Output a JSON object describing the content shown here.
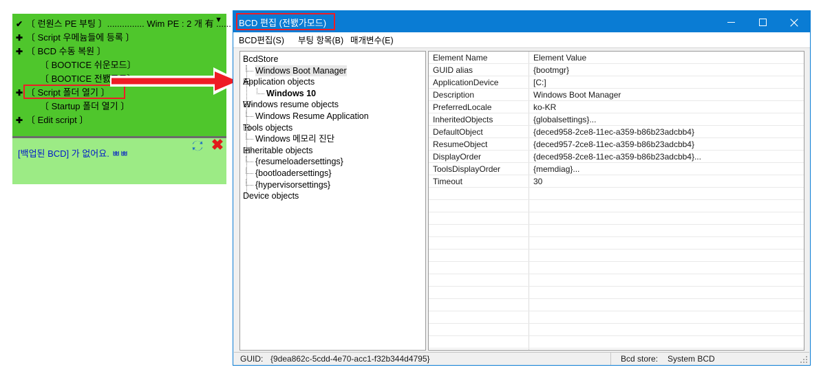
{
  "colors": {
    "accent_blue": "#0a7cd4",
    "panel_green": "#4fc62c",
    "log_green": "#9ceb85",
    "annotation_red": "#ee1c25",
    "log_text_blue": "#0018c8"
  },
  "green_panel": {
    "menu_items": [
      {
        "mark": "✔",
        "label": "〔 런원스 PE 부팅 〕............... Wim PE : 2 개 有 ......",
        "indent": false
      },
      {
        "mark": "✚",
        "label": "〔 Script 우메늄들에 등록 〕",
        "indent": false
      },
      {
        "mark": "✚",
        "label": "〔 BCD 수동 복원 〕",
        "indent": false
      },
      {
        "mark": "",
        "label": "〔 BOOTICE 쉬운모드〕",
        "indent": true
      },
      {
        "mark": "",
        "label": "〔 BOOTICE 전봸모드〕",
        "indent": true
      },
      {
        "mark": "✚",
        "label": "〔 Script 폴더 열기 〕",
        "indent": false
      },
      {
        "mark": "",
        "label": "〔 Startup 폴더 열기 〕",
        "indent": true
      },
      {
        "mark": "✚",
        "label": "〔 Edit script 〕",
        "indent": false
      }
    ],
    "dropdown_caret": "▼",
    "log_text": "[백업된 BCD] 가 없어요. ㅃㅃ",
    "refresh_icon": "refresh-icon",
    "close_icon": "close-x-icon"
  },
  "annotation": {
    "arrow": "red-right-arrow",
    "highlight_menu_item": "〔 BOOTICE 전봸모드〕",
    "highlight_title": "BCD 편집 (전봸가모드)"
  },
  "window": {
    "title": "BCD 편집 (전봸가모드)",
    "controls": {
      "minimize": "minimize-icon",
      "maximize": "maximize-icon",
      "close": "close-icon"
    },
    "menubar": [
      "BCD편집(S)",
      "부팅 항목(B)",
      "매개변수(E)"
    ]
  },
  "tree": {
    "nodes": [
      {
        "label": "BcdStore",
        "depth": 0,
        "expander": false,
        "bold": false,
        "selected": false
      },
      {
        "label": "Windows Boot Manager",
        "depth": 1,
        "expander": false,
        "bold": false,
        "selected": true
      },
      {
        "label": "Application objects",
        "depth": 0,
        "expander": true,
        "bold": false,
        "selected": false
      },
      {
        "label": "Windows 10",
        "depth": 2,
        "expander": false,
        "bold": true,
        "selected": false
      },
      {
        "label": "Windows resume objects",
        "depth": 0,
        "expander": true,
        "bold": false,
        "selected": false
      },
      {
        "label": "Windows Resume Application",
        "depth": 1,
        "expander": false,
        "bold": false,
        "selected": false
      },
      {
        "label": "Tools objects",
        "depth": 0,
        "expander": true,
        "bold": false,
        "selected": false
      },
      {
        "label": "Windows 메모리 진단",
        "depth": 1,
        "expander": false,
        "bold": false,
        "selected": false
      },
      {
        "label": "Inheritable objects",
        "depth": 0,
        "expander": true,
        "bold": false,
        "selected": false
      },
      {
        "label": "{resumeloadersettings}",
        "depth": 1,
        "expander": false,
        "bold": false,
        "selected": false
      },
      {
        "label": "{bootloadersettings}",
        "depth": 1,
        "expander": false,
        "bold": false,
        "selected": false
      },
      {
        "label": "{hypervisorsettings}",
        "depth": 1,
        "expander": false,
        "bold": false,
        "selected": false
      },
      {
        "label": "Device objects",
        "depth": 0,
        "expander": false,
        "bold": false,
        "selected": false
      }
    ]
  },
  "table": {
    "headers": [
      "Element Name",
      "Element Value"
    ],
    "rows": [
      [
        "GUID alias",
        "{bootmgr}"
      ],
      [
        "ApplicationDevice",
        "[C:]"
      ],
      [
        "Description",
        "Windows Boot Manager"
      ],
      [
        "PreferredLocale",
        "ko-KR"
      ],
      [
        "InheritedObjects",
        "{globalsettings}..."
      ],
      [
        "DefaultObject",
        "{deced958-2ce8-11ec-a359-b86b23adcbb4}"
      ],
      [
        "ResumeObject",
        "{deced957-2ce8-11ec-a359-b86b23adcbb4}"
      ],
      [
        "DisplayOrder",
        "{deced958-2ce8-11ec-a359-b86b23adcbb4}..."
      ],
      [
        "ToolsDisplayOrder",
        "{memdiag}..."
      ],
      [
        "Timeout",
        "30"
      ]
    ],
    "empty_row_count": 13
  },
  "statusbar": {
    "guid_label": "GUID:",
    "guid_value": "{9dea862c-5cdd-4e70-acc1-f32b344d4795}",
    "store_label": "Bcd store:",
    "store_value": "System BCD"
  }
}
